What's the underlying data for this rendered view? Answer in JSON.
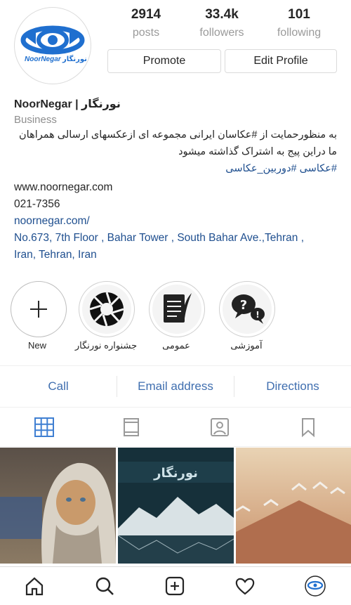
{
  "profile": {
    "username": "NoorNegar | نورنگار",
    "category": "Business",
    "logo_text_en": "NoorNegar",
    "logo_text_fa": "نورنگار",
    "bio_line1": "به منظورحمایت از #عکاسان ایرانی مجموعه ای ازعکسهای ارسالی همراهان",
    "bio_line2": "ما دراین پیج به اشتراک گذاشته میشود",
    "bio_tags": "#عکاسی #دوربین_عکاسی",
    "website": "www.noornegar.com",
    "phone": "021-7356",
    "link": "noornegar.com/",
    "address_line1": "No.673, 7th Floor , Bahar Tower , South Bahar Ave.,Tehran ,",
    "address_line2": "Iran, Tehran, Iran"
  },
  "stats": [
    {
      "value": "2914",
      "label": "posts"
    },
    {
      "value": "33.4k",
      "label": "followers"
    },
    {
      "value": "101",
      "label": "following"
    }
  ],
  "buttons": {
    "promote": "Promote",
    "edit_profile": "Edit Profile"
  },
  "highlights": [
    {
      "label": "New",
      "icon": "plus-icon"
    },
    {
      "label": "جشنواره نورنگار",
      "icon": "camera-aperture-icon"
    },
    {
      "label": "عمومی",
      "icon": "document-quill-icon"
    },
    {
      "label": "آموزشی",
      "icon": "speech-question-icon"
    }
  ],
  "actions": {
    "call": "Call",
    "email": "Email address",
    "directions": "Directions"
  },
  "tabs": [
    {
      "name": "grid-icon",
      "active": true
    },
    {
      "name": "feed-icon",
      "active": false
    },
    {
      "name": "tagged-icon",
      "active": false
    },
    {
      "name": "saved-icon",
      "active": false
    }
  ],
  "festival_poster_title": "نورنگار",
  "colors": {
    "brand_blue": "#1f6fcf",
    "link_blue": "#3f6eaf",
    "text": "#262626",
    "muted": "#8e8e8e"
  }
}
